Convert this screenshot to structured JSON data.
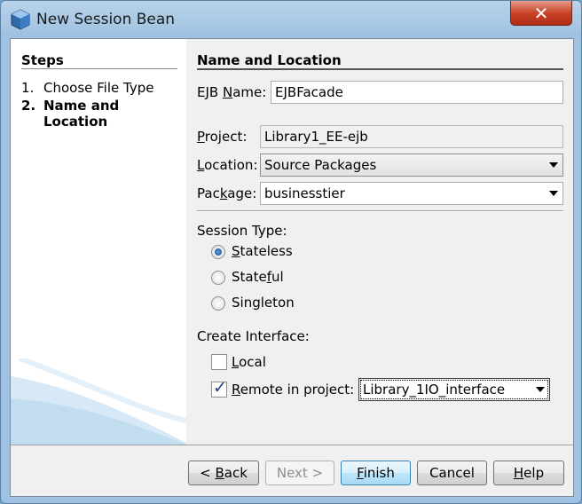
{
  "window": {
    "title": "New Session Bean",
    "close_glyph": "✕",
    "icon": "netbeans-cube-icon"
  },
  "steps": {
    "title": "Steps",
    "items": [
      {
        "num": "1.",
        "label": "Choose File Type"
      },
      {
        "num": "2.",
        "label_line1": "Name and",
        "label_line2": "Location"
      }
    ]
  },
  "main": {
    "title": "Name and Location",
    "ejb_name": {
      "label_pre": "EJB ",
      "label_key": "N",
      "label_post": "ame:",
      "value": "EJBFacade"
    },
    "project": {
      "label_key": "P",
      "label_post": "roject:",
      "value": "Library1_EE-ejb"
    },
    "location": {
      "label_key": "L",
      "label_post": "ocation:",
      "value": "Source Packages"
    },
    "package": {
      "label_pre": "Pac",
      "label_key": "k",
      "label_post": "age:",
      "value": "businesstier"
    },
    "session_type": {
      "label": "Session Type:",
      "options": [
        {
          "key": "S",
          "rest": "tateless",
          "selected": true
        },
        {
          "pre": "State",
          "key": "f",
          "rest": "ul",
          "selected": false
        },
        {
          "pre": "Sin",
          "key": "g",
          "rest": "leton",
          "selected": false
        }
      ]
    },
    "create_interface": {
      "label": "Create Interface:",
      "local": {
        "key": "L",
        "rest": "ocal",
        "checked": false
      },
      "remote": {
        "key": "R",
        "rest": "emote in project:",
        "checked": true,
        "project": "Library_1IO_interface"
      }
    }
  },
  "buttons": {
    "back": {
      "pre": "< ",
      "key": "B",
      "rest": "ack"
    },
    "next": "Next >",
    "finish": {
      "key": "F",
      "rest": "inish"
    },
    "cancel": "Cancel",
    "help": {
      "key": "H",
      "rest": "elp"
    }
  },
  "colors": {
    "title_bar": "#9fc2e2",
    "close_button": "#c9432a",
    "default_button": "#bee6fd"
  }
}
